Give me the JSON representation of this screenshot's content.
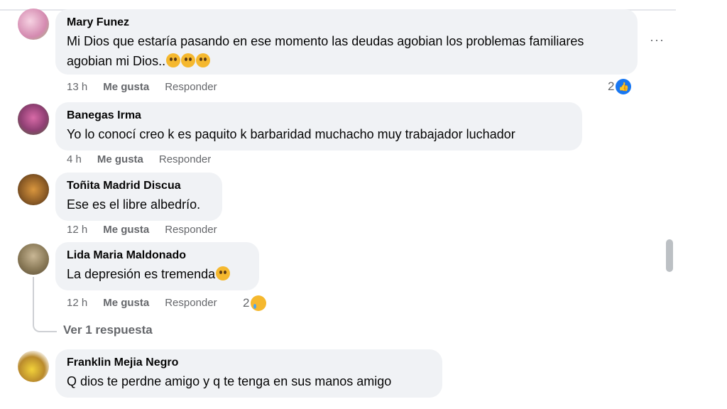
{
  "comments": [
    {
      "name": "Mary Funez",
      "text": "Mi Dios que estaría pasando en ese momento las deudas agobian los problemas familiares agobian mi Dios..",
      "time": "13 h",
      "like_label": "Me gusta",
      "reply_label": "Responder",
      "reaction_count": "2",
      "reaction_icon": "like-icon"
    },
    {
      "name": "Banegas Irma",
      "text": "Yo lo conocí creo k es paquito k barbaridad muchacho muy trabajador luchador",
      "time": "4 h",
      "like_label": "Me gusta",
      "reply_label": "Responder"
    },
    {
      "name": "Toñita Madrid Discua",
      "text": "Ese es el libre albedrío.",
      "time": "12 h",
      "like_label": "Me gusta",
      "reply_label": "Responder"
    },
    {
      "name": "Lida Maria Maldonado",
      "text": "La depresión es tremenda",
      "time": "12 h",
      "like_label": "Me gusta",
      "reply_label": "Responder",
      "reaction_count": "2",
      "reaction_icon": "sad-icon",
      "replies_link": "Ver 1 respuesta"
    },
    {
      "name": "Franklin Mejia Negro",
      "text": "Q dios te perdne amigo y q te tenga en sus manos amigo"
    }
  ],
  "more_options": "···",
  "colors": {
    "bubble": "#f0f2f5",
    "meta": "#65676b",
    "like": "#1877f2"
  }
}
